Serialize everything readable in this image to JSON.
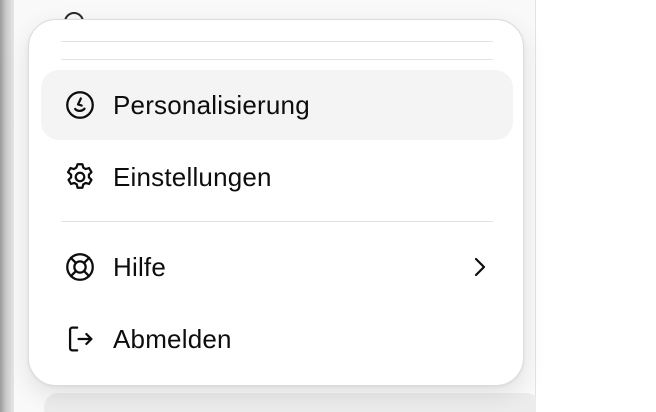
{
  "menu": {
    "items": [
      {
        "label": "Personalisierung",
        "icon": "personalization-icon",
        "active": true
      },
      {
        "label": "Einstellungen",
        "icon": "gear-icon",
        "active": false
      },
      {
        "label": "Hilfe",
        "icon": "lifebuoy-icon",
        "has_submenu": true
      },
      {
        "label": "Abmelden",
        "icon": "logout-icon",
        "active": false
      }
    ]
  },
  "colors": {
    "menu_background": "#ffffff",
    "active_item_background": "#f4f4f4",
    "text": "#0d0d0d",
    "divider": "#e2e2e2"
  }
}
